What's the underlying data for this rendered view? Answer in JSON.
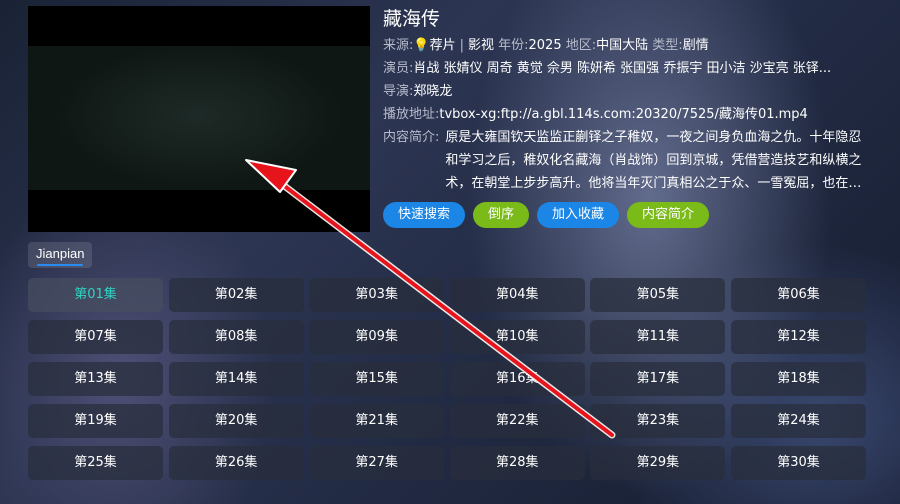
{
  "detail": {
    "title": "藏海传",
    "source_label": "来源:",
    "source_value": "💡荐片",
    "source_sep": "|",
    "source_type": "影视",
    "year_label": "年份:",
    "year_value": "2025",
    "region_label": "地区:",
    "region_value": "中国大陆",
    "genre_label": "类型:",
    "genre_value": "剧情",
    "cast_label": "演员:",
    "cast_value": "肖战 张婧仪 周奇 黄觉 佘男 陈妍希 张国强 乔振宇 田小洁 沙宝亮 张铎...",
    "director_label": "导演:",
    "director_value": "郑晓龙",
    "url_label": "播放地址:",
    "url_value": "tvbox-xg:ftp://a.gbl.114s.com:20320/7525/藏海传01.mp4",
    "summary_label": "内容简介:",
    "summary_value": "原是大雍国钦天监监正蒯铎之子稚奴，一夜之间身负血海之仇。十年隐忍和学习之后，稚奴化名藏海（肖战饰）回到京城，凭借营造技艺和纵横之术，在朝堂上步步高升。他将当年灭门真相公之于众、一雪冤屈，也在逐..."
  },
  "buttons": {
    "quick_search": "快速搜索",
    "reverse": "倒序",
    "add_favorite": "加入收藏",
    "summary": "内容简介"
  },
  "source_tab": "Jianpian",
  "episodes": [
    "第01集",
    "第02集",
    "第03集",
    "第04集",
    "第05集",
    "第06集",
    "第07集",
    "第08集",
    "第09集",
    "第10集",
    "第11集",
    "第12集",
    "第13集",
    "第14集",
    "第15集",
    "第16集",
    "第17集",
    "第18集",
    "第19集",
    "第20集",
    "第21集",
    "第22集",
    "第23集",
    "第24集",
    "第25集",
    "第26集",
    "第27集",
    "第28集",
    "第29集",
    "第30集"
  ],
  "colors": {
    "active_episode": "#2fd3c2",
    "button_blue": "#1b86e6",
    "button_green": "#7bbb19",
    "arrow": "#e8141c"
  }
}
